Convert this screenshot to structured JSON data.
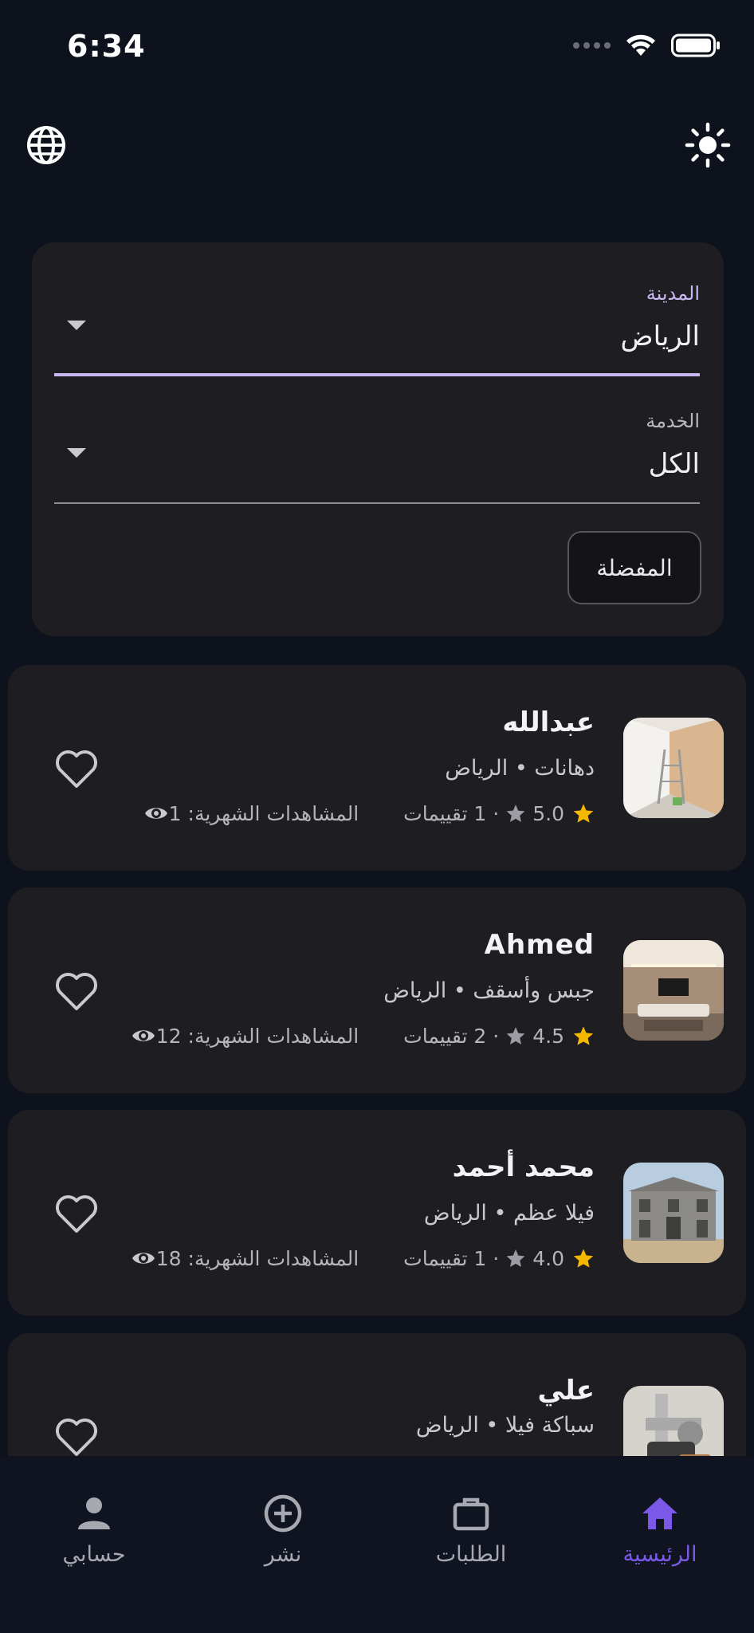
{
  "status_bar": {
    "time": "6:34"
  },
  "top_bar": {
    "language_icon": "globe-icon",
    "theme_icon": "sun-icon"
  },
  "filters": {
    "city": {
      "label": "المدينة",
      "value": "الرياض"
    },
    "service": {
      "label": "الخدمة",
      "value": "الكل"
    },
    "favorites_label": "المفضلة"
  },
  "listings": [
    {
      "name": "عبدالله",
      "subtitle": "دهانات • الرياض",
      "rating": "5.0",
      "reviews": "· 1 تقييمات",
      "views": "المشاهدات الشهرية: 1",
      "image": "painting-room"
    },
    {
      "name": "Ahmed",
      "subtitle": "جبس وأسقف • الرياض",
      "rating": "4.5",
      "reviews": "· 2 تقييمات",
      "views": "المشاهدات الشهرية: 12",
      "image": "living-room-ceiling"
    },
    {
      "name": "محمد أحمد",
      "subtitle": "فيلا عظم • الرياض",
      "rating": "4.0",
      "reviews": "· 1 تقييمات",
      "views": "المشاهدات الشهرية: 18",
      "image": "villa-construction"
    },
    {
      "name": "علي",
      "subtitle": "سباكة فيلا • الرياض",
      "image": "plumbing"
    }
  ],
  "bottom_nav": [
    {
      "label": "الرئيسية",
      "icon": "home-icon",
      "active": true
    },
    {
      "label": "الطلبات",
      "icon": "briefcase-icon",
      "active": false
    },
    {
      "label": "نشر",
      "icon": "add-circle-icon",
      "active": false
    },
    {
      "label": "حسابي",
      "icon": "person-icon",
      "active": false
    }
  ],
  "colors": {
    "background": "#0d121c",
    "card": "#1d1d22",
    "accent": "#c7b8f0",
    "nav_active": "#7b58e8",
    "star": "#f5b800"
  }
}
